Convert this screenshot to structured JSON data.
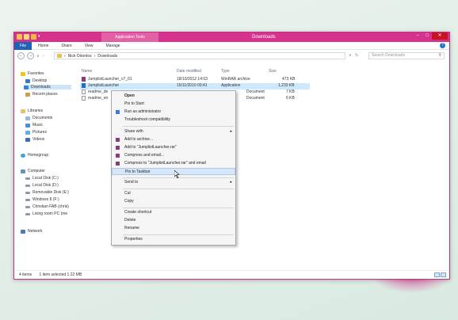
{
  "window": {
    "title": "Downloads",
    "context_tab": "Application Tools",
    "quick_access_dropdown": "▾",
    "controls": {
      "minimize": "–",
      "maximize": "□",
      "close": "✕"
    }
  },
  "ribbon": {
    "tabs": [
      "File",
      "Home",
      "Share",
      "View",
      "Manage"
    ],
    "help": "?"
  },
  "addressbar": {
    "back": "←",
    "forward": "→",
    "dropdown": "∨",
    "up": "↑",
    "crumbs": [
      "›",
      "Nick Odontos",
      "›",
      "Downloads"
    ],
    "dropdown2": "∨",
    "refresh": "↻",
    "search_placeholder": "Search Downloads",
    "search_icon": "⚲"
  },
  "nav": {
    "favorites_label": "Favorites",
    "favorites": [
      "Desktop",
      "Downloads",
      "Recent places"
    ],
    "libraries_label": "Libraries",
    "libraries": [
      "Documents",
      "Music",
      "Pictures",
      "Videos"
    ],
    "homegroup": "Homegroup",
    "computer_label": "Computer",
    "drives": [
      "Local Disk (C:)",
      "Local Disk (D:)",
      "Removable Disk (E:)",
      "Windows 8 (F:)",
      "Christian FAB (chris)",
      "Living room PC (me"
    ],
    "network": "Network"
  },
  "columns": {
    "name": "Name",
    "date": "Date modified",
    "type": "Type",
    "size": "Size"
  },
  "files": [
    {
      "name": "JumplistLauncher_v7_01",
      "date": "18/10/2012 14:03",
      "type": "WinRAR archive",
      "size": "473 KB"
    },
    {
      "name": "JumplistLauncher",
      "date": "15/11/2010 09:41",
      "type": "Application",
      "size": "1,233 KB"
    },
    {
      "name": "readme_de",
      "date": "",
      "type": "Document",
      "size": "7 KB"
    },
    {
      "name": "readme_en",
      "date": "",
      "type": "Document",
      "size": "6 KB"
    }
  ],
  "context_menu": {
    "open": "Open",
    "pin_start": "Pin to Start",
    "run_admin": "Run as administrator",
    "troubleshoot": "Troubleshoot compatibility",
    "share_with": "Share with",
    "add_archive": "Add to archive...",
    "add_to_rar": "Add to \"JumplistLauncher.rar\"",
    "compress_email": "Compress and email...",
    "compress_rar_email": "Compress to \"JumplistLauncher.rar\" and email",
    "pin_taskbar": "Pin to Taskbar",
    "send_to": "Send to",
    "cut": "Cut",
    "copy": "Copy",
    "create_shortcut": "Create shortcut",
    "delete": "Delete",
    "rename": "Rename",
    "properties": "Properties",
    "submenu_arrow": "▸"
  },
  "status": {
    "items": "4 items",
    "selected": "1 item selected  1.22 MB"
  },
  "colors": {
    "accent": "#d6318c",
    "file_tab": "#1e63b8",
    "selection": "#cde8ff"
  }
}
